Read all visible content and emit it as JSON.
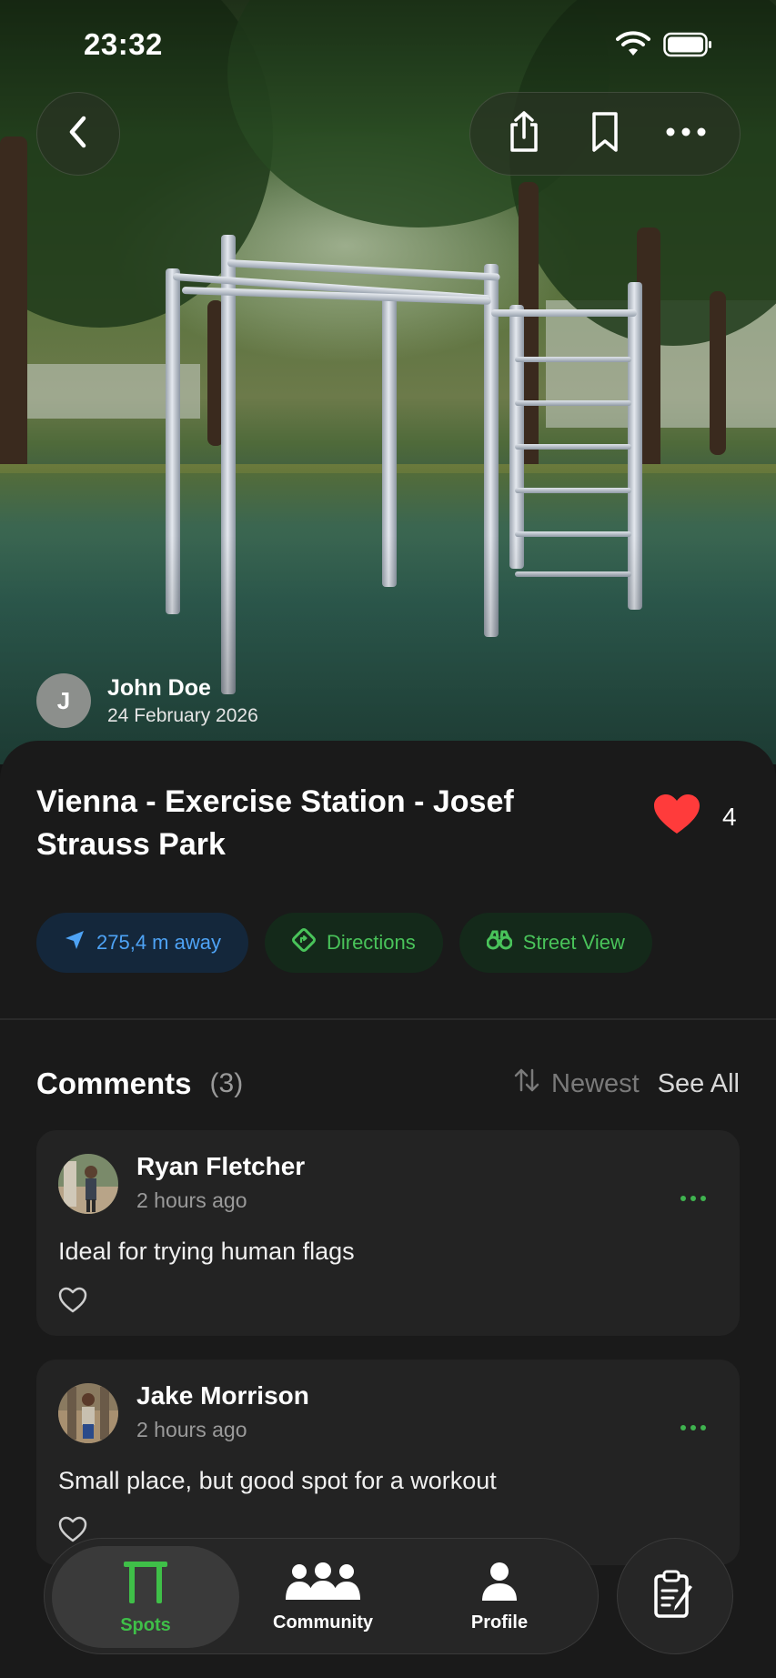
{
  "status": {
    "time": "23:32"
  },
  "hero": {
    "author_initial": "J",
    "author_name": "John Doe",
    "author_date": "24 February 2026"
  },
  "spot": {
    "title": "Vienna - Exercise Station - Josef Strauss Park",
    "likes": "4"
  },
  "chips": {
    "distance": "275,4 m away",
    "directions": "Directions",
    "street_view": "Street View"
  },
  "comments": {
    "title": "Comments",
    "count": "(3)",
    "sort_label": "Newest",
    "see_all": "See All",
    "items": [
      {
        "name": "Ryan Fletcher",
        "time": "2 hours ago",
        "text": "Ideal for trying human flags"
      },
      {
        "name": "Jake Morrison",
        "time": "2 hours ago",
        "text": "Small place, but good spot for a workout"
      }
    ]
  },
  "tabbar": {
    "spots": "Spots",
    "community": "Community",
    "profile": "Profile"
  },
  "colors": {
    "accent_green": "#3fbf48",
    "like_red": "#ff3b3b",
    "distance_blue": "#4ea3f5"
  }
}
